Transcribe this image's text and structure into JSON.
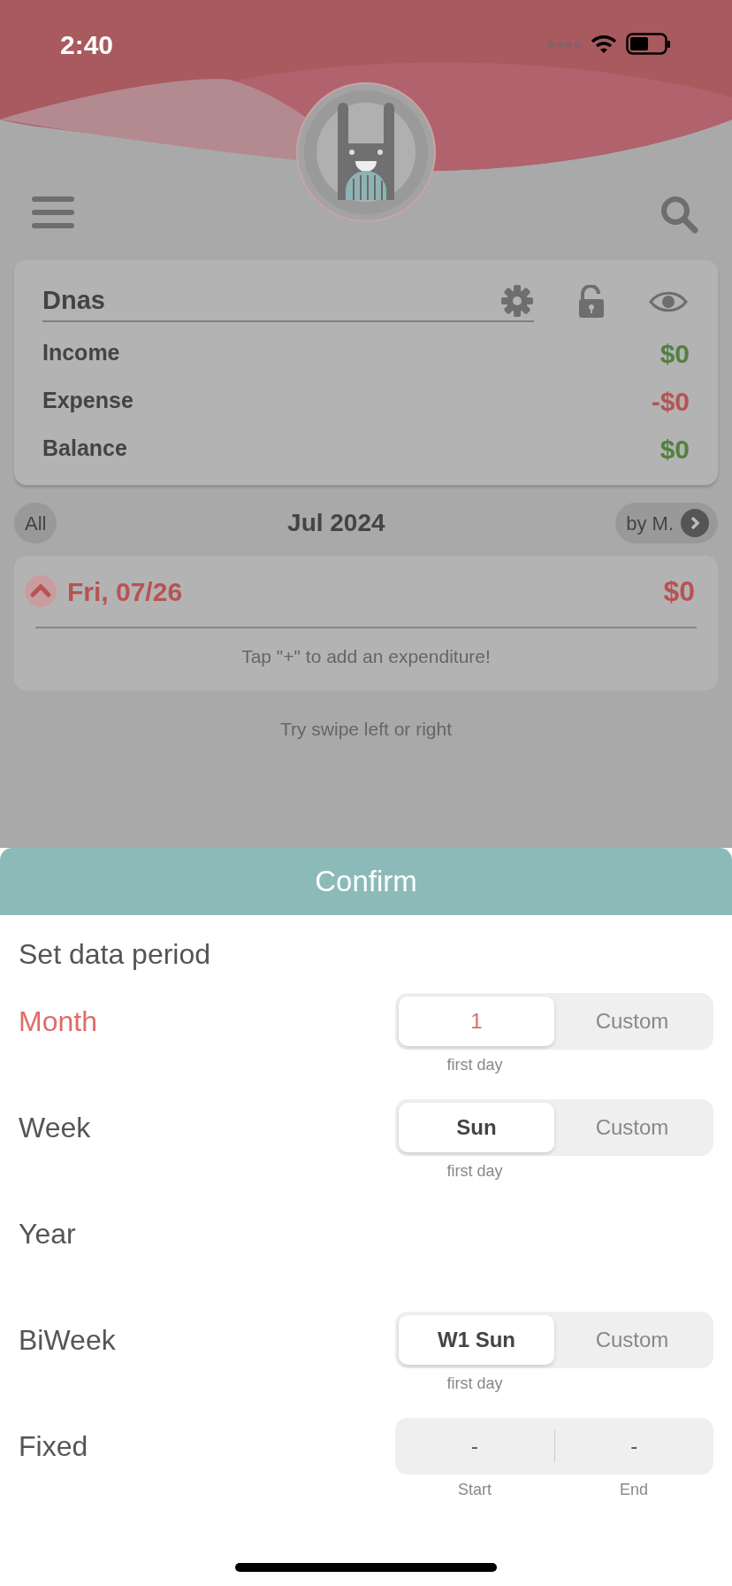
{
  "status_bar": {
    "time": "2:40"
  },
  "account": {
    "name": "Dnas",
    "rows": [
      {
        "label": "Income",
        "amount": "$0",
        "color": "#53803f"
      },
      {
        "label": "Expense",
        "amount": "-$0",
        "color": "#b85353"
      },
      {
        "label": "Balance",
        "amount": "$0",
        "color": "#53803f"
      }
    ]
  },
  "period_bar": {
    "left": "All",
    "title": "Jul 2024",
    "right": "by M."
  },
  "day": {
    "date": "Fri, 07/26",
    "amount": "$0",
    "expanded": true,
    "hint": "Tap \"+\" to add an expenditure!"
  },
  "swipe_hint": "Try swipe left or right",
  "sheet": {
    "confirm": "Confirm",
    "title": "Set data period",
    "periods": [
      {
        "label": "Month",
        "selected": true,
        "kind": "segmented",
        "options": [
          {
            "label": "1",
            "selected": true
          },
          {
            "label": "Custom",
            "selected": false
          }
        ],
        "caption": "first day"
      },
      {
        "label": "Week",
        "selected": false,
        "kind": "segmented",
        "options": [
          {
            "label": "Sun",
            "selected": true
          },
          {
            "label": "Custom",
            "selected": false
          }
        ],
        "caption": "first day"
      },
      {
        "label": "Year",
        "selected": false,
        "kind": "none"
      },
      {
        "label": "BiWeek",
        "selected": false,
        "kind": "segmented",
        "options": [
          {
            "label": "W1 Sun",
            "selected": true
          },
          {
            "label": "Custom",
            "selected": false
          }
        ],
        "caption": "first day"
      },
      {
        "label": "Fixed",
        "selected": false,
        "kind": "range",
        "start": "-",
        "end": "-",
        "start_caption": "Start",
        "end_caption": "End"
      }
    ]
  }
}
